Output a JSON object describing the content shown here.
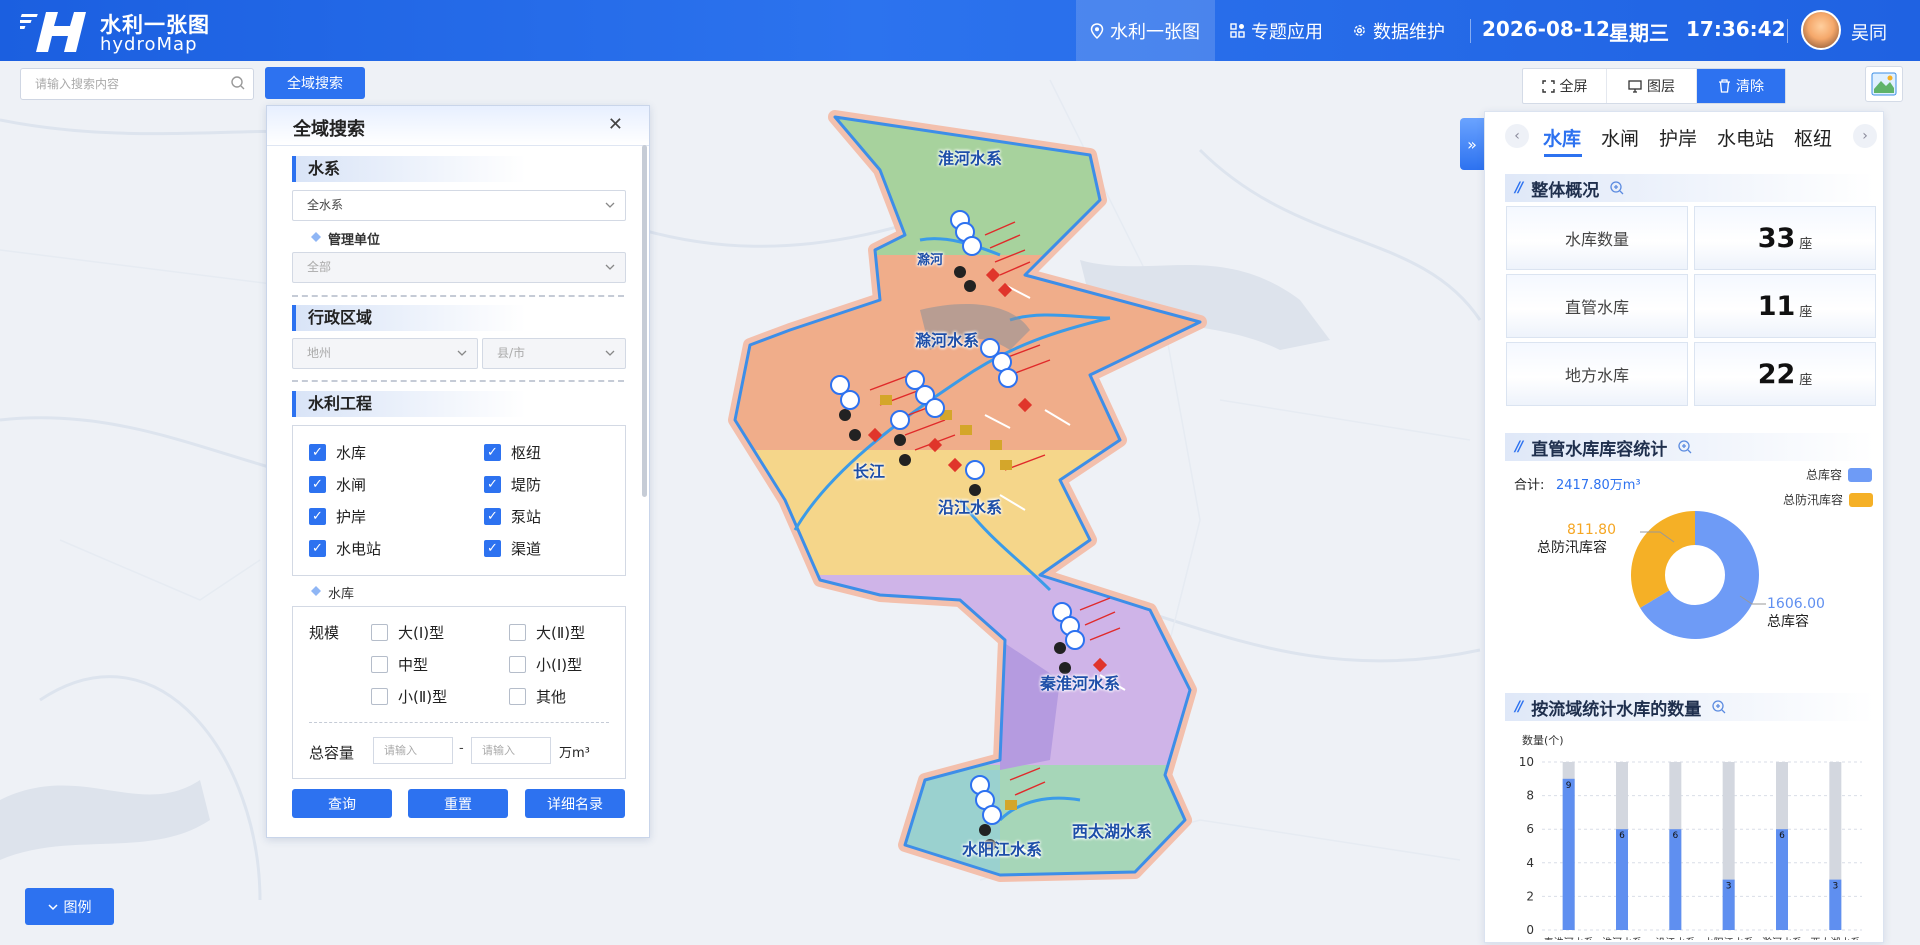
{
  "header": {
    "title_cn": "水利一张图",
    "title_en": "hydroMap",
    "nav": [
      "水利一张图",
      "专题应用",
      "数据维护"
    ],
    "date": "2026-08-12",
    "weekday": "星期三",
    "time": "17:36:42",
    "user": "吴同"
  },
  "search": {
    "placeholder": "请输入搜索内容",
    "button": "全域搜索"
  },
  "toolbar": {
    "fullscreen": "全屏",
    "layers": "图层",
    "clear": "清除"
  },
  "panel": {
    "title": "全域搜索",
    "water_system": {
      "label": "水系",
      "selected": "全水系",
      "mgmt_label": "管理单位",
      "mgmt_selected": "全部"
    },
    "region": {
      "label": "行政区域",
      "city_placeholder": "地州",
      "county_placeholder": "县/市"
    },
    "project": {
      "label": "水利工程",
      "items": [
        "水库",
        "枢纽",
        "水闸",
        "堤防",
        "护岸",
        "泵站",
        "水电站",
        "渠道"
      ]
    },
    "reservoir": {
      "label": "水库",
      "scale_label": "规模",
      "scales": [
        "大(Ⅰ)型",
        "大(Ⅱ)型",
        "中型",
        "小(Ⅰ)型",
        "小(Ⅱ)型",
        "其他"
      ],
      "capacity_label": "总容量",
      "min_placeholder": "请输入",
      "max_placeholder": "请输入",
      "dash": "-",
      "unit": "万m³"
    },
    "buttons": {
      "query": "查询",
      "reset": "重置",
      "detail": "详细名录"
    }
  },
  "map_labels": [
    "淮河水系",
    "滁河",
    "滁河水系",
    "长江",
    "沿江水系",
    "秦淮河水系",
    "西太湖水系",
    "水阳江水系"
  ],
  "legend_button": "图例",
  "right": {
    "tabs": [
      "水库",
      "水闸",
      "护岸",
      "水电站",
      "枢纽"
    ],
    "overview": {
      "title": "整体概况",
      "rows": [
        {
          "label": "水库数量",
          "value": "33",
          "unit": "座"
        },
        {
          "label": "直管水库",
          "value": "11",
          "unit": "座"
        },
        {
          "label": "地方水库",
          "value": "22",
          "unit": "座"
        }
      ]
    },
    "capacity": {
      "title": "直管水库库容统计",
      "total_label": "合计:",
      "total_value": "2417.80万m³",
      "legend": [
        "总库容",
        "总防汛库容"
      ],
      "colors": [
        "#6e9bf6",
        "#f5b026"
      ],
      "slices": [
        {
          "name": "总库容",
          "value": 1606.0,
          "label": "1606.00"
        },
        {
          "name": "总防汛库容",
          "value": 811.8,
          "label": "811.80"
        }
      ]
    },
    "basin": {
      "title": "按流域统计水库的数量",
      "chart_data": {
        "type": "bar",
        "ylabel": "数量(个)",
        "ylim": [
          0,
          10
        ],
        "yticks": [
          "0",
          "2",
          "4",
          "6",
          "8",
          "10"
        ],
        "categories": [
          "秦淮河水系",
          "淮河水系",
          "沿江水系",
          "水阳江水系",
          "滁河水系",
          "西太湖水系"
        ],
        "values": [
          9,
          6,
          6,
          3,
          6,
          3
        ],
        "labels": [
          "9",
          "6",
          "6",
          "3",
          "6",
          "3"
        ]
      }
    }
  }
}
